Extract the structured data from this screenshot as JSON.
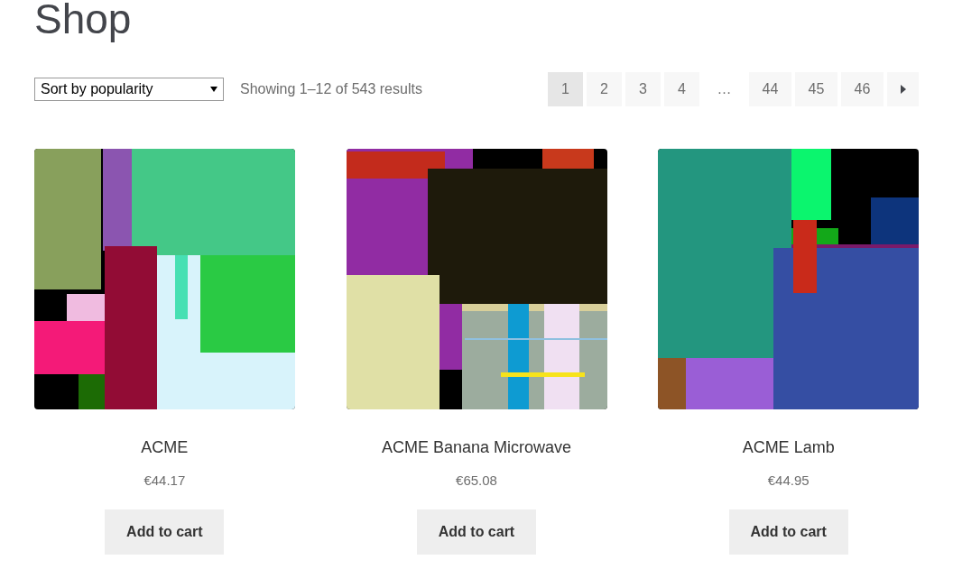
{
  "page_title": "Shop",
  "sort_select": {
    "value": "Sort by popularity"
  },
  "result_count": "Showing 1–12 of 543 results",
  "pagination": [
    {
      "label": "1",
      "selected": true,
      "kind": "page"
    },
    {
      "label": "2",
      "selected": false,
      "kind": "page"
    },
    {
      "label": "3",
      "selected": false,
      "kind": "page"
    },
    {
      "label": "4",
      "selected": false,
      "kind": "page"
    },
    {
      "label": "…",
      "selected": false,
      "kind": "dots"
    },
    {
      "label": "44",
      "selected": false,
      "kind": "page"
    },
    {
      "label": "45",
      "selected": false,
      "kind": "page"
    },
    {
      "label": "46",
      "selected": false,
      "kind": "page"
    },
    {
      "selected": false,
      "kind": "next"
    }
  ],
  "products": [
    {
      "name": "ACME",
      "price": "€44.17",
      "button": "Add to cart"
    },
    {
      "name": "ACME Banana Microwave",
      "price": "€65.08",
      "button": "Add to cart"
    },
    {
      "name": "ACME Lamb",
      "price": "€44.95",
      "button": "Add to cart"
    }
  ]
}
